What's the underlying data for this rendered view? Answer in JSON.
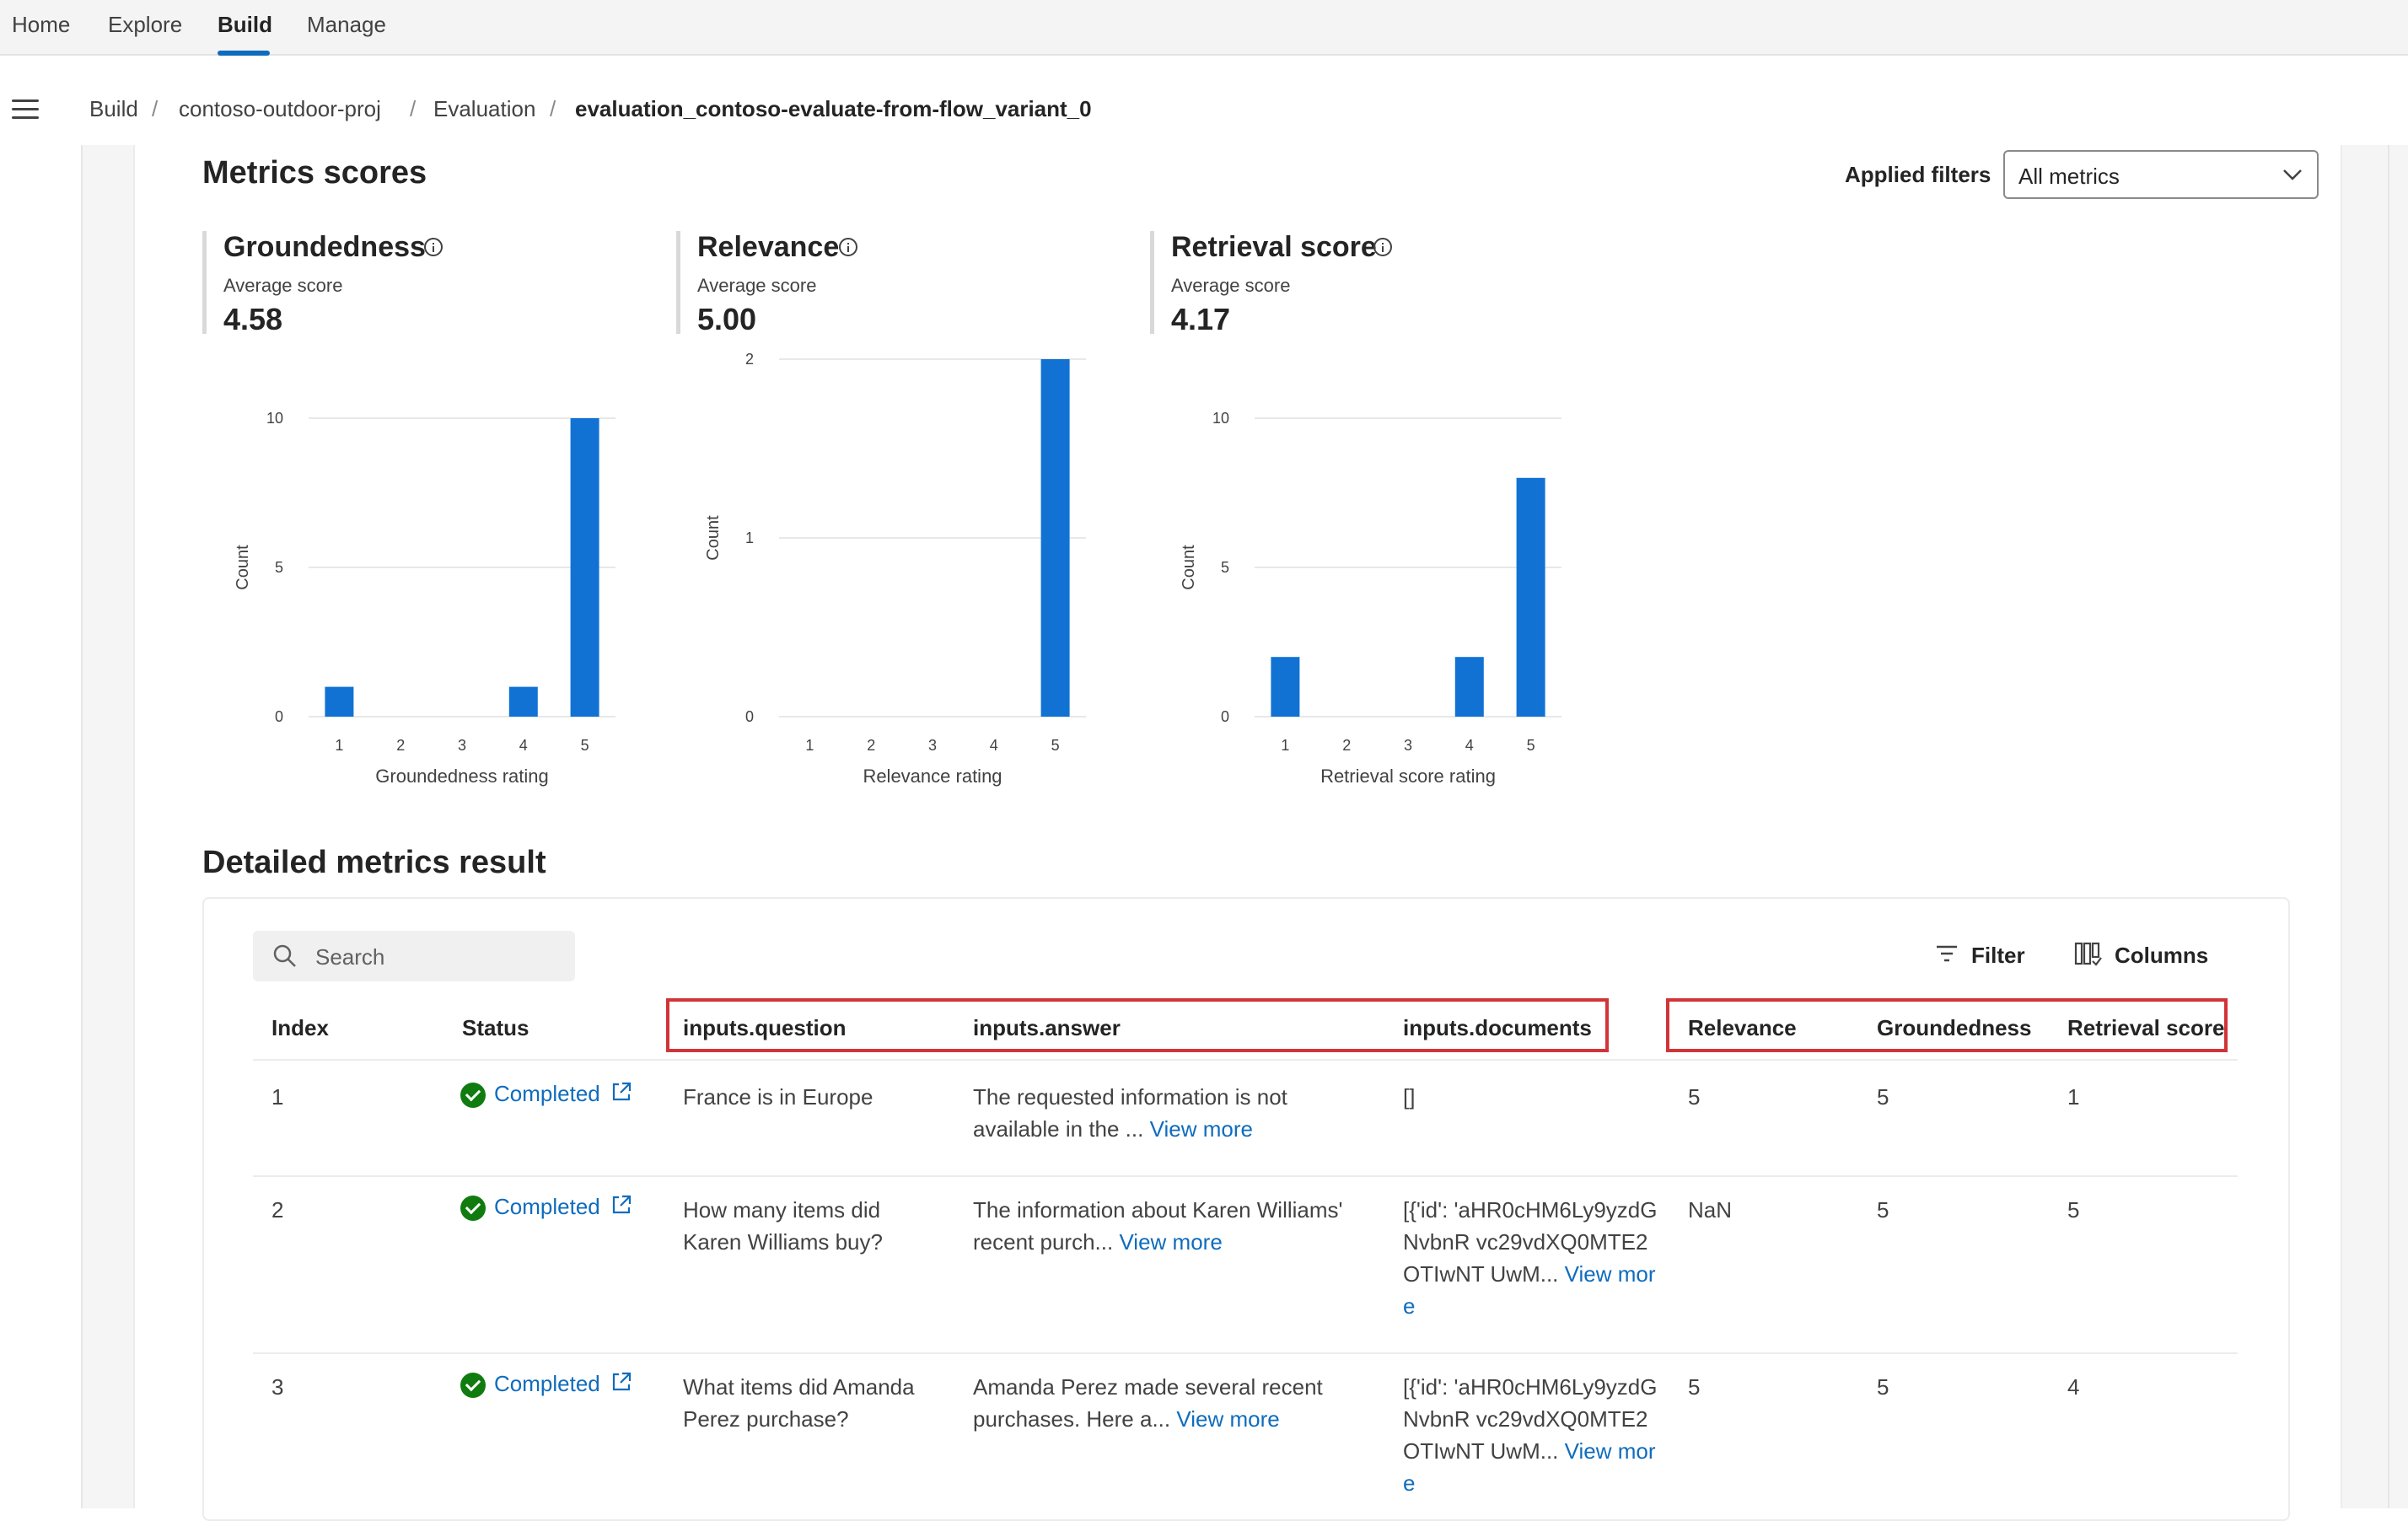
{
  "nav": {
    "tabs": [
      "Home",
      "Explore",
      "Build",
      "Manage"
    ],
    "active_tab": "Build"
  },
  "breadcrumb": [
    "Build",
    "contoso-outdoor-proj",
    "Evaluation",
    "evaluation_contoso-evaluate-from-flow_variant_0"
  ],
  "metrics_section": {
    "title": "Metrics scores",
    "filter_label": "Applied filters",
    "filter_value": "All metrics"
  },
  "cards": [
    {
      "title": "Groundedness",
      "label": "Average score",
      "value": "4.58"
    },
    {
      "title": "Relevance",
      "label": "Average score",
      "value": "5.00"
    },
    {
      "title": "Retrieval score",
      "label": "Average score",
      "value": "4.17"
    }
  ],
  "chart_data": [
    {
      "type": "bar",
      "categories": [
        "1",
        "2",
        "3",
        "4",
        "5"
      ],
      "values": [
        1,
        0,
        0,
        1,
        10
      ],
      "xlabel": "Groundedness rating",
      "ylabel": "Count",
      "yticks": [
        0,
        5,
        10
      ],
      "ylim": [
        0,
        10
      ],
      "grid": true,
      "color": "#1172d4"
    },
    {
      "type": "bar",
      "categories": [
        "1",
        "2",
        "3",
        "4",
        "5"
      ],
      "values": [
        0,
        0,
        0,
        0,
        2
      ],
      "xlabel": "Relevance rating",
      "ylabel": "Count",
      "yticks": [
        0,
        1,
        2
      ],
      "ylim": [
        0,
        2
      ],
      "grid": true,
      "color": "#1172d4"
    },
    {
      "type": "bar",
      "categories": [
        "1",
        "2",
        "3",
        "4",
        "5"
      ],
      "values": [
        2,
        0,
        0,
        2,
        8
      ],
      "xlabel": "Retrieval score rating",
      "ylabel": "Count",
      "yticks": [
        0,
        5,
        10
      ],
      "ylim": [
        0,
        10
      ],
      "grid": true,
      "color": "#1172d4"
    }
  ],
  "detail_section": {
    "title": "Detailed metrics result"
  },
  "toolbar": {
    "search_placeholder": "Search",
    "filter_label": "Filter",
    "columns_label": "Columns"
  },
  "table": {
    "columns": [
      "Index",
      "Status",
      "inputs.question",
      "inputs.answer",
      "inputs.documents",
      "Relevance",
      "Groundedness",
      "Retrieval score"
    ],
    "view_more": "View more",
    "rows": [
      {
        "index": "1",
        "status": "Completed",
        "question": "France is in Europe",
        "answer": "The requested information is not available in the ...",
        "documents": "[]",
        "doc_view_more": false,
        "relevance": "5",
        "groundedness": "5",
        "retrieval": "1"
      },
      {
        "index": "2",
        "status": "Completed",
        "question": "How many items did Karen Williams buy?",
        "answer": "The information about Karen Williams' recent purch...",
        "documents": "[{'id': 'aHR0cHM6Ly9yzdGNvbnR vc29vdXQ0MTE2OTIwNT UwM...",
        "doc_view_more": true,
        "relevance": "NaN",
        "groundedness": "5",
        "retrieval": "5"
      },
      {
        "index": "3",
        "status": "Completed",
        "question": "What items did Amanda Perez purchase?",
        "answer": "Amanda Perez made several recent purchases. Here a...",
        "documents": "[{'id': 'aHR0cHM6Ly9yzdGNvbnR vc29vdXQ0MTE2OTIwNT UwM...",
        "doc_view_more": true,
        "relevance": "5",
        "groundedness": "5",
        "retrieval": "4"
      }
    ]
  }
}
